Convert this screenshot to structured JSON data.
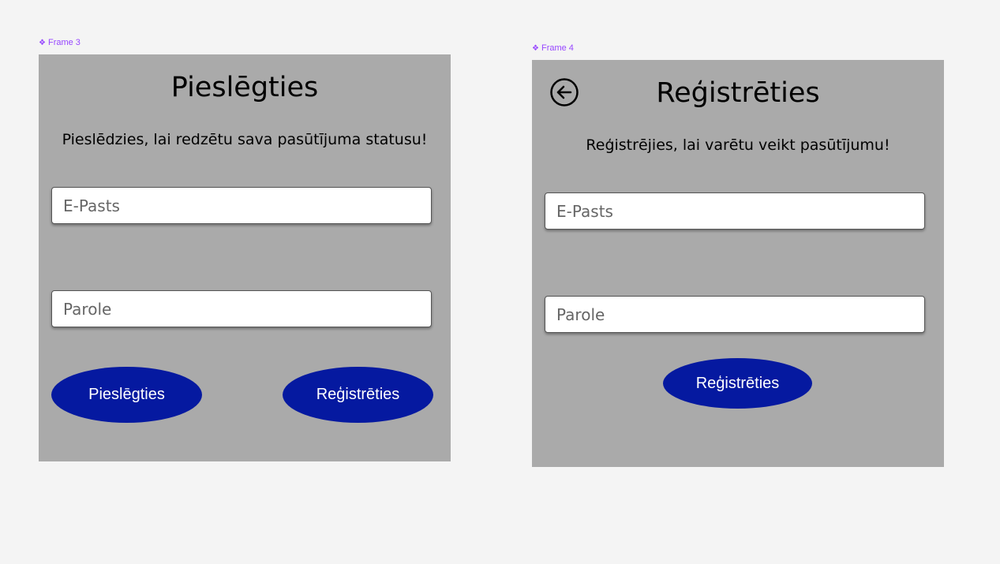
{
  "frame3": {
    "label": "Frame 3",
    "title": "Pieslēgties",
    "subtitle": "Pieslēdzies, lai redzētu sava pasūtījuma statusu!",
    "email_placeholder": "E-Pasts",
    "password_placeholder": "Parole",
    "login_button": "Pieslēgties",
    "register_button": "Reģistrēties"
  },
  "frame4": {
    "label": "Frame 4",
    "title": "Reģistrēties",
    "subtitle": "Reģistrējies, lai varētu veikt pasūtījumu!",
    "email_placeholder": "E-Pasts",
    "password_placeholder": "Parole",
    "register_button": "Reģistrēties",
    "back_icon": "arrow-left-circle"
  },
  "colors": {
    "canvas": "#f4f4f4",
    "frame_bg": "#aaaaaa",
    "button": "#0519a0",
    "frame_label": "#9747ff"
  }
}
